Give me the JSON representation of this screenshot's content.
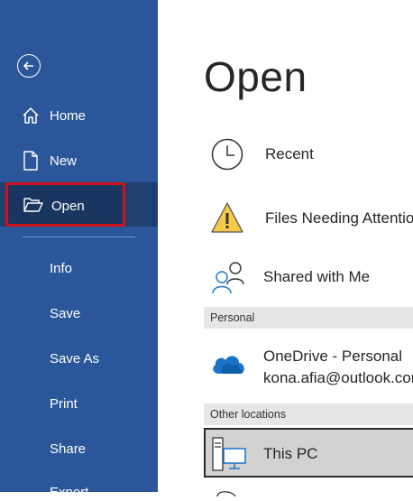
{
  "sidebar": {
    "items": [
      {
        "label": "Home"
      },
      {
        "label": "New"
      },
      {
        "label": "Open"
      },
      {
        "label": "Info"
      },
      {
        "label": "Save"
      },
      {
        "label": "Save As"
      },
      {
        "label": "Print"
      },
      {
        "label": "Share"
      },
      {
        "label": "Export"
      }
    ],
    "bg_color": "#2b579a",
    "highlight_color": "#d0121b"
  },
  "main": {
    "title": "Open",
    "locations": [
      {
        "label": "Recent",
        "icon": "clock-icon"
      },
      {
        "label": "Files Needing Attention",
        "icon": "warning-icon"
      },
      {
        "label": "Shared with Me",
        "icon": "people-icon"
      }
    ],
    "personal_header": "Personal",
    "onedrive": {
      "label": "OneDrive - Personal",
      "email": "kona.afia@outlook.com"
    },
    "other_header": "Other locations",
    "this_pc": {
      "label": "This PC"
    }
  }
}
